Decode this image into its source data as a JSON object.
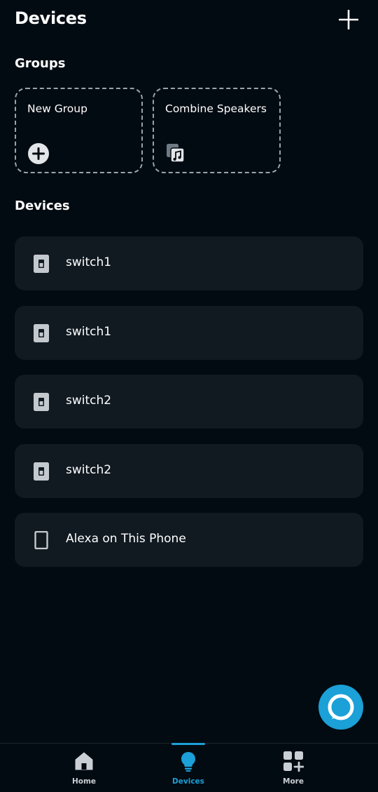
{
  "header": {
    "title": "Devices"
  },
  "groups": {
    "title": "Groups",
    "cards": [
      {
        "label": "New Group",
        "icon": "plus-circle-icon"
      },
      {
        "label": "Combine Speakers",
        "icon": "speaker-music-icon"
      }
    ]
  },
  "devices": {
    "title": "Devices",
    "items": [
      {
        "label": "switch1",
        "icon": "light-switch-icon"
      },
      {
        "label": "switch1",
        "icon": "light-switch-icon"
      },
      {
        "label": "switch2",
        "icon": "light-switch-icon"
      },
      {
        "label": "switch2",
        "icon": "light-switch-icon"
      },
      {
        "label": "Alexa on This Phone",
        "icon": "phone-icon"
      }
    ]
  },
  "nav": {
    "items": [
      {
        "label": "Home",
        "icon": "home-icon",
        "active": false
      },
      {
        "label": "Devices",
        "icon": "lightbulb-icon",
        "active": true
      },
      {
        "label": "More",
        "icon": "grid-plus-icon",
        "active": false
      }
    ]
  },
  "colors": {
    "background": "#030b12",
    "card": "#111a21",
    "accent": "#1ba0d8"
  }
}
